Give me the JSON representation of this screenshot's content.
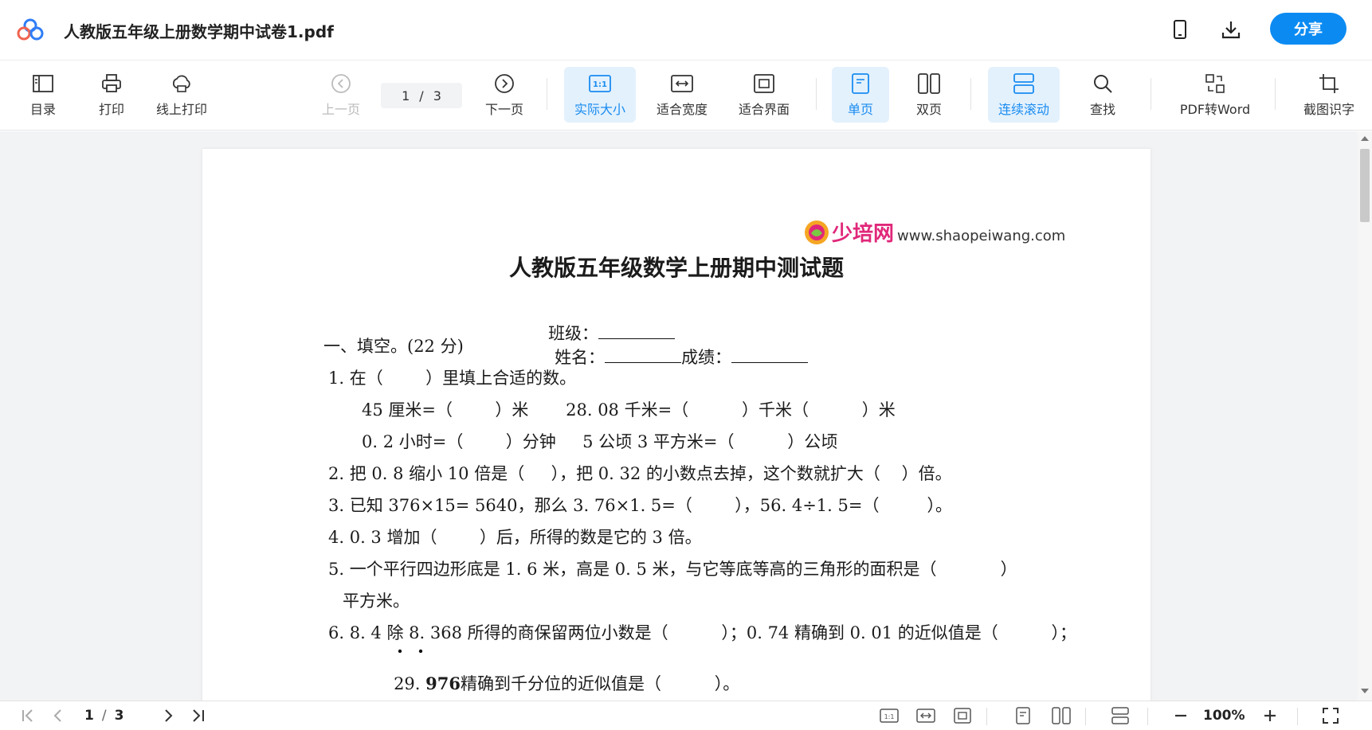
{
  "title_bar": {
    "doc_title": "人教版五年级上册数学期中试卷1.pdf",
    "share_label": "分享",
    "icons": [
      "mobile-icon",
      "download-icon"
    ]
  },
  "toolbar": {
    "toc": "目录",
    "print": "打印",
    "online_print": "线上打印",
    "prev_page": "上一页",
    "page_current": "1",
    "page_sep": "/",
    "page_total": "3",
    "next_page": "下一页",
    "actual_size": "实际大小",
    "fit_width": "适合宽度",
    "fit_screen": "适合界面",
    "single_page": "单页",
    "double_page": "双页",
    "continuous_scroll": "连续滚动",
    "find": "查找",
    "pdf_to_word": "PDF转Word",
    "screenshot_ocr": "截图识字",
    "active_color": "#1a8cf0"
  },
  "document": {
    "watermark_name": "少培网",
    "watermark_url": "www.shaopeiwang.com",
    "exam_title": "人教版五年级数学上册期中测试题",
    "info_class": "班级：",
    "info_name": "姓名：",
    "info_score": "成绩：",
    "section1": "一、填空。(22 分)",
    "q1": "1. 在（        ）里填上合适的数。",
    "q1a": "45 厘米=（        ）米       28. 08 千米=（          ）千米（          ）米",
    "q1b": "0. 2 小时=（        ）分钟     5 公顷 3 平方米=（          ）公顷",
    "q2": "2. 把 0. 8 缩小 10 倍是（     ），把 0. 32 的小数点去掉，这个数就扩大（    ）倍。",
    "q3": "3. 已知 376×15= 5640，那么 3. 76×1. 5=（        ），56. 4÷1. 5=（         ）。",
    "q4": "4. 0. 3 增加（        ）后，所得的数是它的 3 倍。",
    "q5": "5. 一个平行四边形底是 1. 6 米，高是 0. 5 米，与它等底等高的三角形的面积是（            ）",
    "q5b": "平方米。",
    "q6": "6. 8. 4 除 8. 368 所得的商保留两位小数是（          ）；0. 74 精确到 0. 01 的近似值是（          ）；",
    "q6b_pre": "29. ",
    "q6b_num": "976",
    "q6b_post": "精确到千分位的近似值是（          ）。"
  },
  "bottom_bar": {
    "page_current": "1",
    "page_sep": "/",
    "page_total": "3",
    "zoom": "100%"
  }
}
